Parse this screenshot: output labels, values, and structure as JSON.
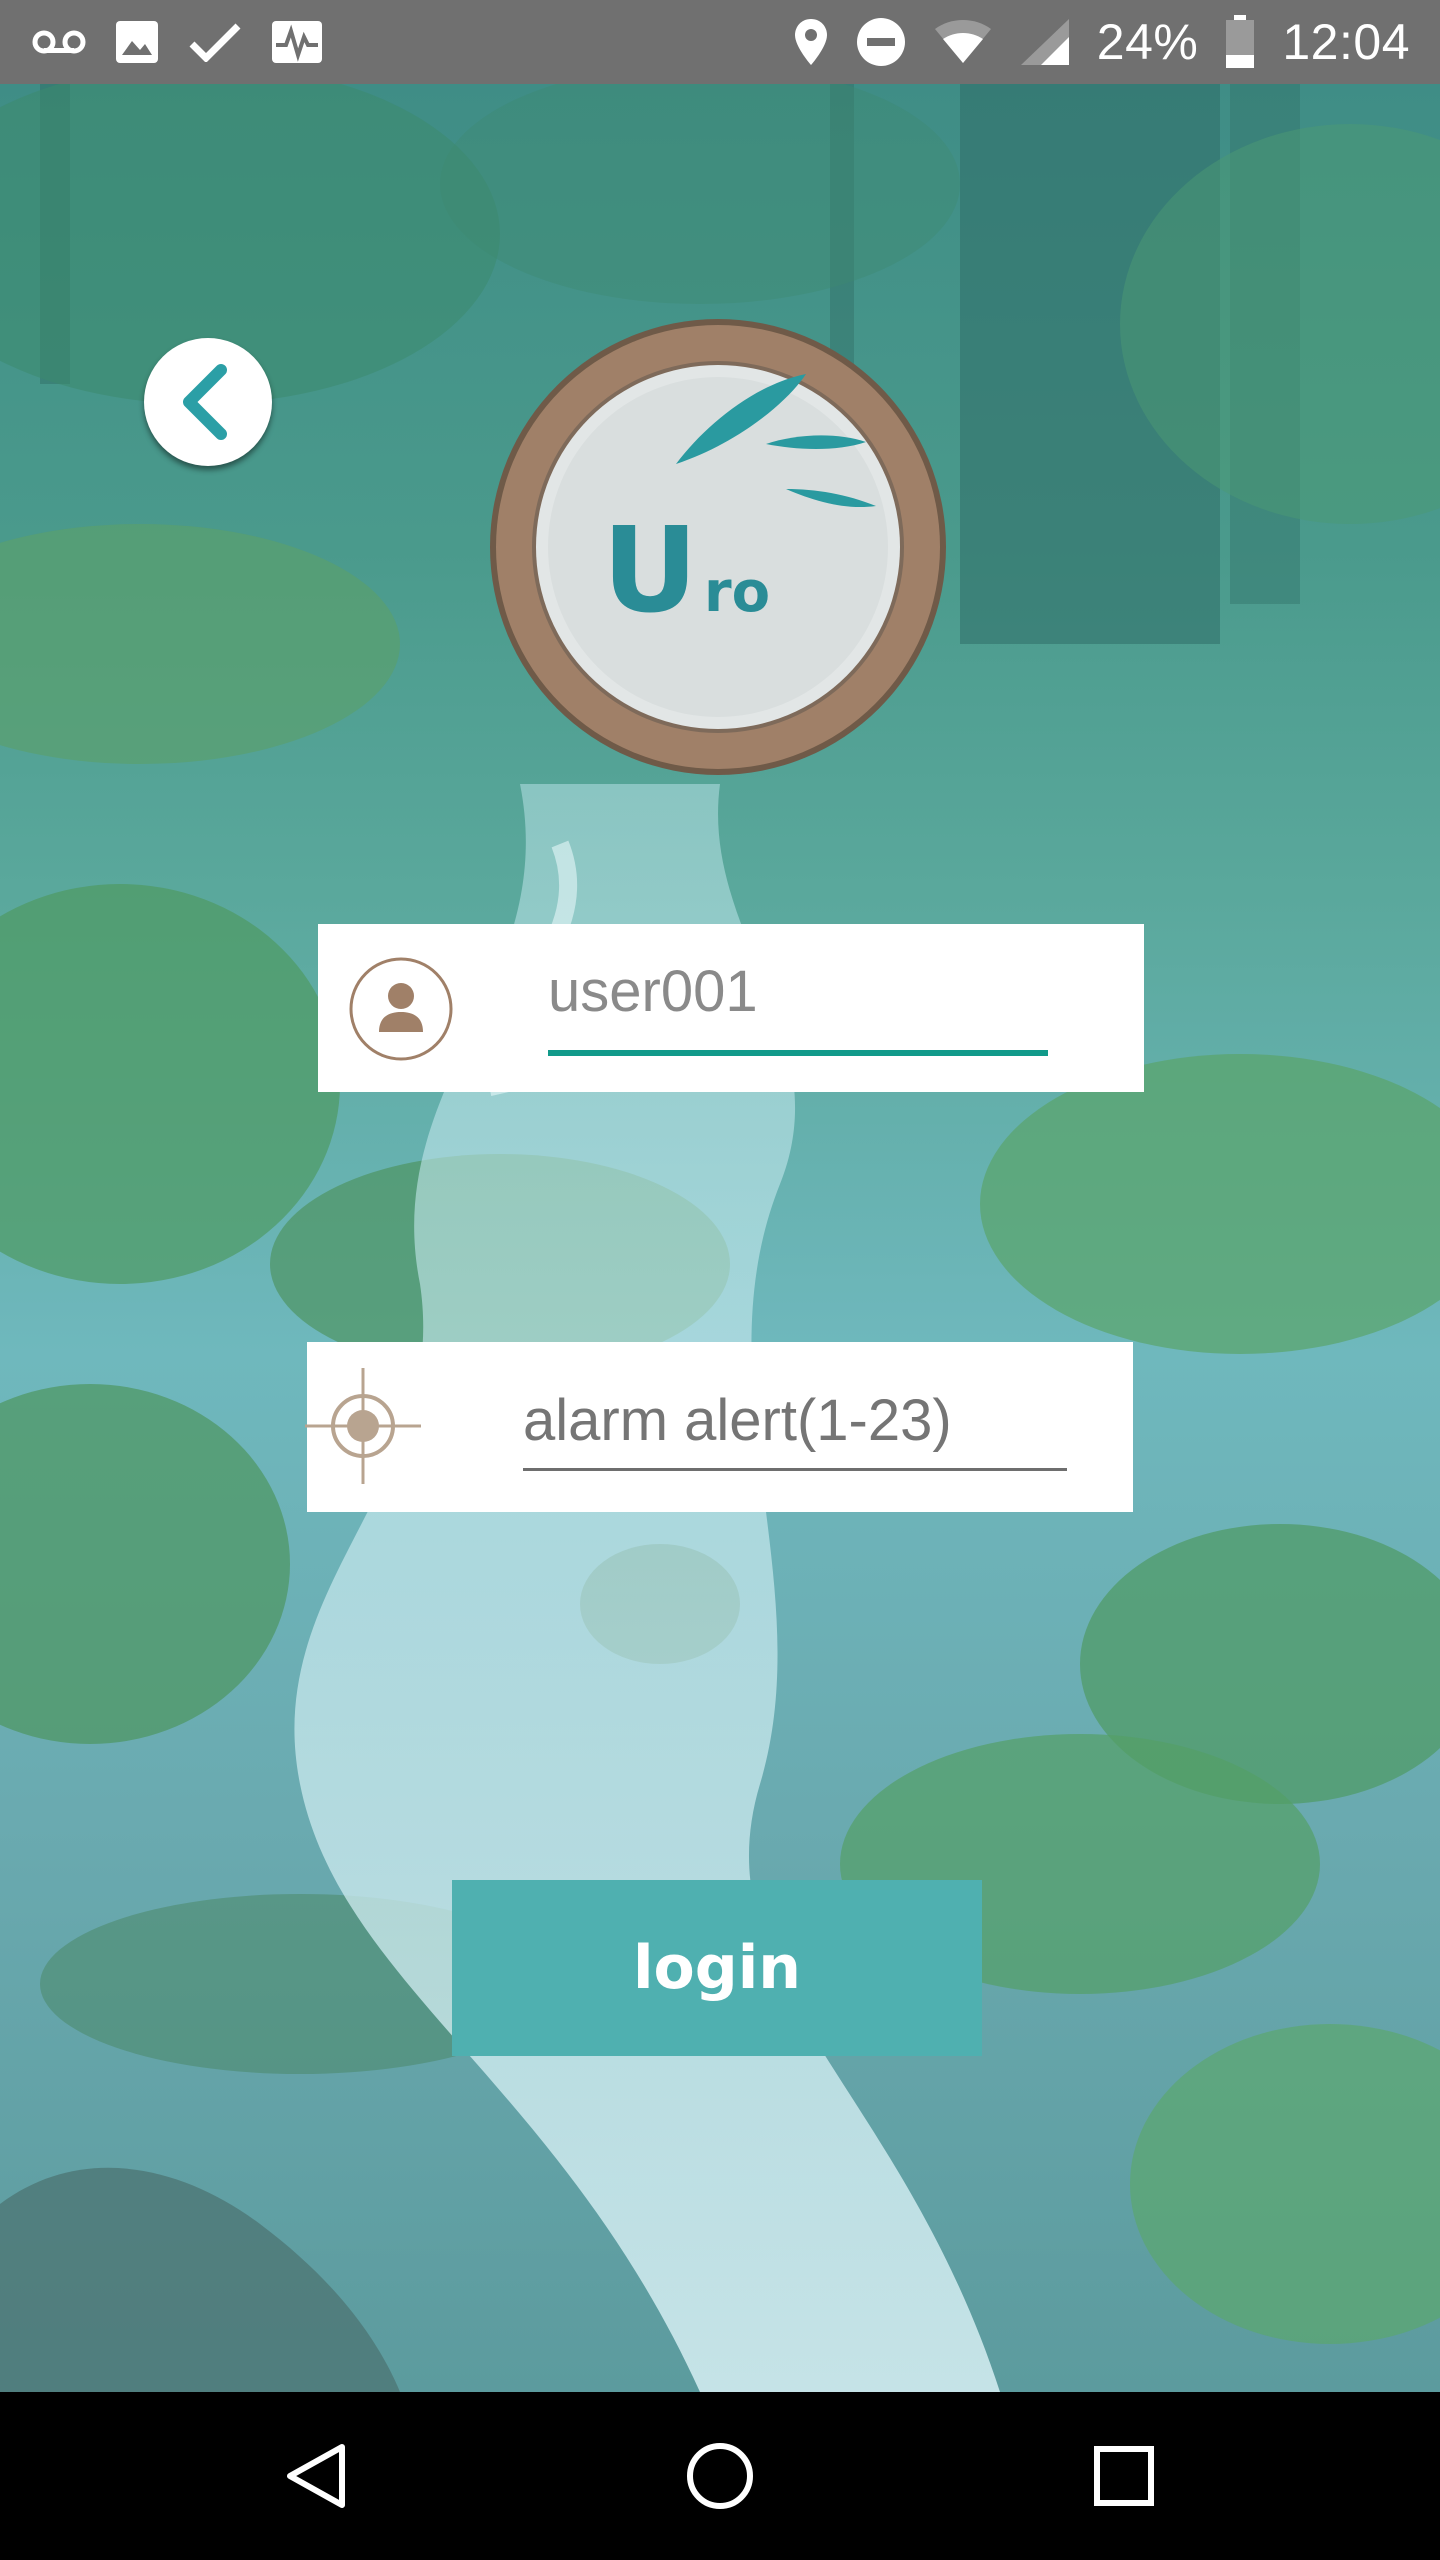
{
  "status_bar": {
    "battery_percent": "24%",
    "time": "12:04",
    "left_icons": [
      "voicemail-icon",
      "image-icon",
      "check-icon",
      "activity-icon"
    ],
    "right_icons": [
      "location-icon",
      "do-not-disturb-icon",
      "wifi-icon",
      "signal-icon",
      "battery-icon"
    ]
  },
  "login_screen": {
    "back_icon": "chevron-left-icon",
    "logo_text_big": "U",
    "logo_text_small": "ro",
    "username": {
      "value": "user001",
      "icon": "user-avatar-icon"
    },
    "alarm": {
      "placeholder": "alarm alert(1-23)",
      "icon": "crosshair-icon"
    },
    "login_label": "login"
  },
  "nav_bar": {
    "back_icon": "nav-back-icon",
    "home_icon": "nav-home-icon",
    "recents_icon": "nav-recents-icon"
  },
  "colors": {
    "accent": "#119a8a",
    "button": "#4fb0b0",
    "logo_ring": "#a08068",
    "status_bar": "#707070"
  }
}
